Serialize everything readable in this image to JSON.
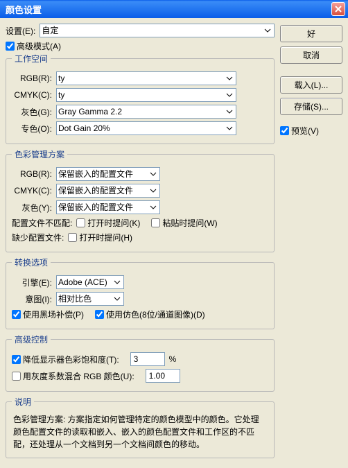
{
  "window_title": "颜色设置",
  "settings_label": "设置(E):",
  "settings_value": "自定",
  "adv_mode": "高级模式(A)",
  "buttons": {
    "ok": "好",
    "cancel": "取消",
    "load": "载入(L)...",
    "save": "存储(S)..."
  },
  "preview": "预览(V)",
  "workspace": {
    "legend": "工作空间",
    "rgb_l": "RGB(R):",
    "rgb_v": "ty",
    "cmyk_l": "CMYK(C):",
    "cmyk_v": "ty",
    "gray_l": "灰色(G):",
    "gray_v": "Gray Gamma 2.2",
    "spot_l": "专色(O):",
    "spot_v": "Dot Gain 20%"
  },
  "policy": {
    "legend": "色彩管理方案",
    "rgb_l": "RGB(R):",
    "rgb_v": "保留嵌入的配置文件",
    "cmyk_l": "CMYK(C):",
    "cmyk_v": "保留嵌入的配置文件",
    "gray_l": "灰色(Y):",
    "gray_v": "保留嵌入的配置文件",
    "mismatch_l": "配置文件不匹配:",
    "mismatch_open": "打开时提问(K)",
    "mismatch_paste": "粘贴时提问(W)",
    "missing_l": "缺少配置文件:",
    "missing_open": "打开时提问(H)"
  },
  "conv": {
    "legend": "转换选项",
    "engine_l": "引擎(E):",
    "engine_v": "Adobe (ACE)",
    "intent_l": "意图(I):",
    "intent_v": "相对比色",
    "blackpoint": "使用黑场补偿(P)",
    "dither": "使用仿色(8位/通道图像)(D)"
  },
  "advctrl": {
    "legend": "高级控制",
    "desat": "降低显示器色彩饱和度(T):",
    "desat_v": "3",
    "pct": "%",
    "blend": "用灰度系数混合 RGB 颜色(U):",
    "blend_v": "1.00"
  },
  "desc": {
    "legend": "说明",
    "text": "色彩管理方案: 方案指定如何管理特定的颜色模型中的颜色。它处理颜色配置文件的读取和嵌入、嵌入的颜色配置文件和工作区的不匹配，还处理从一个文档到另一个文档间颜色的移动。"
  }
}
